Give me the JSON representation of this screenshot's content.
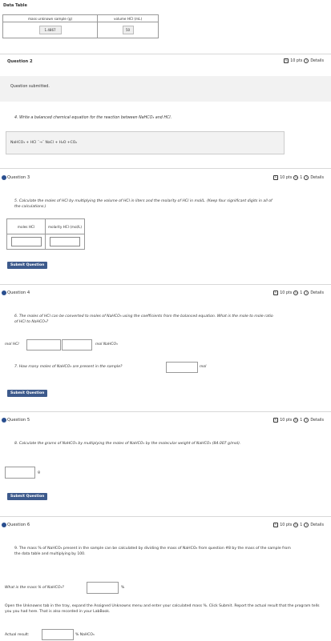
{
  "data_table": {
    "title": "Data Table",
    "col1_header": "mass unknown sample (g)",
    "col2_header": "volume HCl (mL)",
    "col1_value": "1.4867",
    "col2_value": "50"
  },
  "q2": {
    "title": "Question 2",
    "points": "10 pts",
    "details": "Details",
    "submitted": "Question submitted.",
    "prompt": "4. Write a balanced chemical equation for the reaction between NaHCO₃ and HCl.",
    "answer": "NaHCO₃ + HCl  ˉ→ˉ  NaCl + H₂O +CO₂"
  },
  "q3": {
    "title": "Question 3",
    "points": "10 pts",
    "attempts": "1",
    "details": "Details",
    "prompt": "5. Calculate the moles of HCl by multiplying the volume of HCl in liters and the molarity of HCl in mol/L. (Keep four significant digits in all of the calculations.)",
    "col1_header": "moles HCl",
    "col2_header": "molarity HCl (mol/L)",
    "submit": "Submit Question"
  },
  "q4": {
    "title": "Question 4",
    "points": "10 pts",
    "attempts": "1",
    "details": "Details",
    "prompt": "6. The moles of HCl can be converted to moles of NaHCO₃ using the coefficients from the balanced equation. What is the mole to mole ratio of HCl to NaHCO₃?",
    "left_label": "mol HCl",
    "right_label": "mol NaHCO₃",
    "prompt2": "7. How many moles of NaHCO₃ are present in the sample?",
    "unit2": "mol",
    "submit": "Submit Question"
  },
  "q5": {
    "title": "Question 5",
    "points": "10 pts",
    "attempts": "1",
    "details": "Details",
    "prompt": "8. Calculate the grams of NaHCO₃ by multiplying the moles of NaHCO₃ by the molecular weight of NaHCO₃ (84.007 g/mol).",
    "unit": "g",
    "submit": "Submit Question"
  },
  "q6": {
    "title": "Question 6",
    "points": "10 pts",
    "attempts": "1",
    "details": "Details",
    "prompt": "9. The mass % of NaHCO₃ present in the sample can be calculated by dividing the mass of NaHCO₃ from question #8 by the mass of the sample from the data table and multiplying by 100.",
    "ask": "What is the mass % of NaHCO₃?",
    "unit": "%",
    "instructions": "Open the Unknowns tab in the tray, expand the Assigned Unknowns menu and enter your calculated mass %. Click Submit. Report the actual result that the program tells you you had here. That is also recorded in your LabBook.",
    "actual_label": "Actual result:",
    "actual_unit": "% NaHCO₃"
  }
}
